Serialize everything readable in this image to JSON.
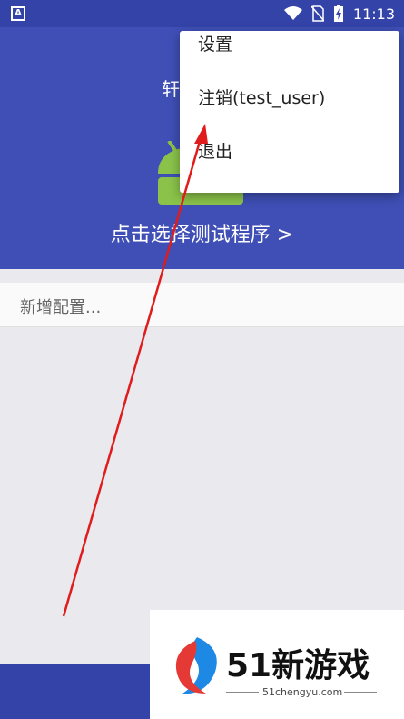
{
  "status_bar": {
    "time": "11:13",
    "icons": [
      "notification-a-icon",
      "wifi-icon",
      "no-sim-icon",
      "battery-charging-icon"
    ]
  },
  "app": {
    "title": "轩",
    "select_program": "点击选择测试程序 >"
  },
  "config": {
    "add_placeholder": "新增配置..."
  },
  "menu": {
    "items": [
      "设置",
      "注销(test_user)",
      "退出"
    ]
  },
  "watermark": {
    "brand": "51新游戏",
    "site": "51chengyu.com"
  },
  "colors": {
    "primary": "#3f4fb6",
    "primary_dark": "#3443a8",
    "android_green": "#8bc34a",
    "annotation_red": "#e01c1c"
  }
}
